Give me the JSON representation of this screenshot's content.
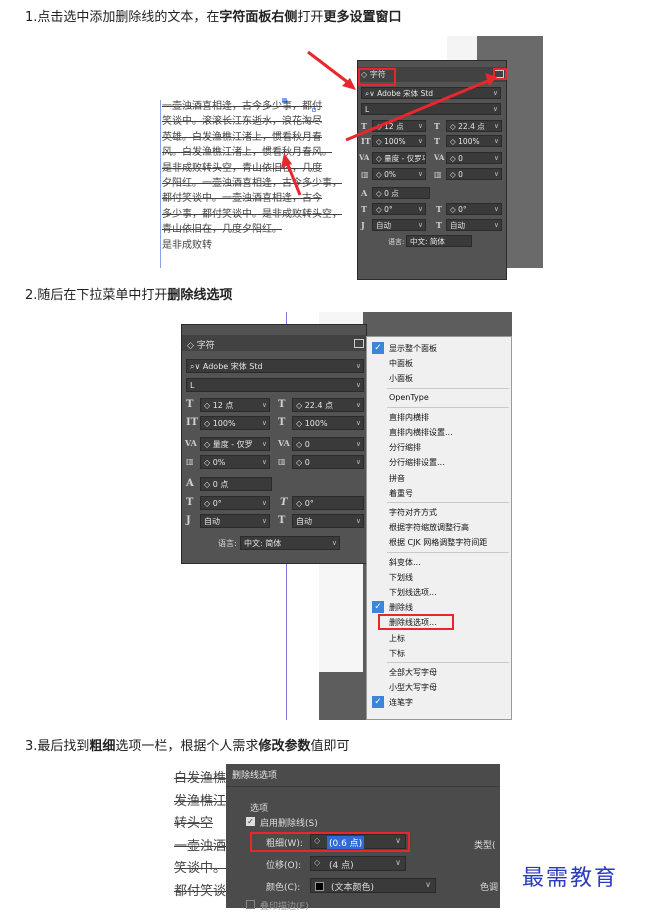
{
  "steps": [
    {
      "prefix": "1.点击选中添加删除线的文本，在",
      "bold1": "字符面板右侧",
      "mid": "打开",
      "bold2": "更多设置窗口"
    },
    {
      "prefix": "2.随后在下拉菜单中打开",
      "bold1": "删除线选项"
    },
    {
      "prefix": "3.最后找到",
      "bold1": "粗细",
      "mid": "选项一栏，根据个人需求",
      "bold2": "修改参数",
      "suffix": "值即可"
    }
  ],
  "doc_text": [
    "一壶浊酒喜相逢，古今多少事，都付",
    "笑谈中。滚滚长江东逝水，浪花淘尽",
    "英雄。白发渔樵江渚上，惯看秋月春",
    "风。白发渔樵江渚上，惯看秋月春风。",
    "是非成败转头空，青山依旧在，几度",
    "夕阳红。一壶浊酒喜相逢，古今多少事，",
    "都付笑谈中。一壶浊酒喜相逢，古今",
    "多少事，都付笑谈中。是非成败转头空，",
    "青山依旧在，几度夕阳红。",
    "是非成败转"
  ],
  "doc_text3": [
    "白发渔樵",
    "发渔樵江渚",
    "转头空",
    "一壶浊酒",
    "笑谈中。一",
    "都付笑谈"
  ],
  "char_panel": {
    "tab": "字符",
    "font": "Adobe 宋体 Std",
    "style": "L",
    "size": "12 点",
    "leading": "22.4 点",
    "vscale": "100%",
    "hscale": "100%",
    "kerning": "量度 - 仅罗马",
    "tracking": "0",
    "tsume": "0%",
    "aki": "0",
    "baseline": "0 点",
    "rotate": "0°",
    "skew": "0°",
    "aki_left": "自动",
    "aki_right": "自动",
    "language_label": "语言:",
    "language": "中文: 简体"
  },
  "char_panel2": {
    "kerning": "量度 - 仅罗"
  },
  "menu": {
    "items": [
      {
        "label": "显示整个面板",
        "checked": true
      },
      {
        "label": "中面板",
        "checked": false
      },
      {
        "label": "小面板",
        "checked": false
      },
      {
        "label": "OpenType",
        "checked": false,
        "sep": true
      },
      {
        "label": "直排内横排",
        "checked": false,
        "sep": true
      },
      {
        "label": "直排内横排设置...",
        "checked": false
      },
      {
        "label": "分行缩排",
        "checked": false
      },
      {
        "label": "分行缩排设置...",
        "checked": false
      },
      {
        "label": "拼音",
        "checked": false
      },
      {
        "label": "着重号",
        "checked": false
      },
      {
        "label": "字符对齐方式",
        "checked": false,
        "sep": true
      },
      {
        "label": "根据字符缩放调整行高",
        "checked": false
      },
      {
        "label": "根据 CJK 网格调整字符间距",
        "checked": false
      },
      {
        "label": "斜变体...",
        "checked": false,
        "sep": true
      },
      {
        "label": "下划线",
        "checked": false
      },
      {
        "label": "下划线选项...",
        "checked": false
      },
      {
        "label": "删除线",
        "checked": true
      },
      {
        "label": "删除线选项...",
        "checked": false
      },
      {
        "label": "上标",
        "checked": false
      },
      {
        "label": "下标",
        "checked": false
      },
      {
        "label": "全部大写字母",
        "checked": false,
        "sep": true
      },
      {
        "label": "小型大写字母",
        "checked": false
      },
      {
        "label": "连笔字",
        "checked": true
      }
    ]
  },
  "dialog": {
    "title": "删除线选项",
    "section": "选项",
    "enable_label": "启用删除线(S)",
    "weight_label": "粗细(W):",
    "weight_value": "(0.6 点)",
    "offset_label": "位移(O):",
    "offset_value": "(4 点)",
    "color_label": "颜色(C):",
    "color_value": "(文本颜色)",
    "type_label": "类型(",
    "tint_label": "色调",
    "overprint_label": "叠印描边(E)"
  },
  "watermark": "最需教育",
  "colors": {
    "highlight": "#e8262b",
    "panel": "#535353",
    "watermark": "#2a3bc0"
  }
}
